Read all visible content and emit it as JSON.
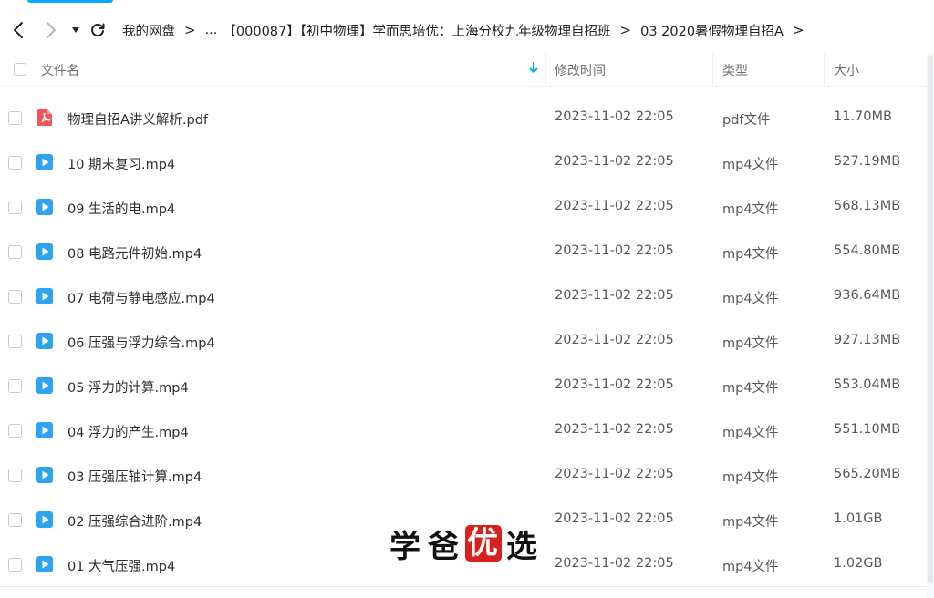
{
  "nav": {
    "breadcrumb": {
      "root": "我的网盘",
      "ellipsis": "...",
      "folder": "【000087】【初中物理】学而思培优：上海分校九年级物理自招班",
      "current": "03 2020暑假物理自招A"
    },
    "separator": ">"
  },
  "table": {
    "columns": {
      "name": "文件名",
      "time": "修改时间",
      "type": "类型",
      "size": "大小"
    },
    "rows": [
      {
        "name": "物理自招A讲义解析.pdf",
        "time": "2023-11-02 22:05",
        "type": "pdf文件",
        "size": "11.70MB",
        "icon": "pdf-icon"
      },
      {
        "name": "10 期末复习.mp4",
        "time": "2023-11-02 22:05",
        "type": "mp4文件",
        "size": "527.19MB",
        "icon": "video-icon"
      },
      {
        "name": "09 生活的电.mp4",
        "time": "2023-11-02 22:05",
        "type": "mp4文件",
        "size": "568.13MB",
        "icon": "video-icon"
      },
      {
        "name": "08 电路元件初始.mp4",
        "time": "2023-11-02 22:05",
        "type": "mp4文件",
        "size": "554.80MB",
        "icon": "video-icon"
      },
      {
        "name": "07 电荷与静电感应.mp4",
        "time": "2023-11-02 22:05",
        "type": "mp4文件",
        "size": "936.64MB",
        "icon": "video-icon"
      },
      {
        "name": "06 压强与浮力综合.mp4",
        "time": "2023-11-02 22:05",
        "type": "mp4文件",
        "size": "927.13MB",
        "icon": "video-icon"
      },
      {
        "name": "05 浮力的计算.mp4",
        "time": "2023-11-02 22:05",
        "type": "mp4文件",
        "size": "553.04MB",
        "icon": "video-icon"
      },
      {
        "name": "04 浮力的产生.mp4",
        "time": "2023-11-02 22:05",
        "type": "mp4文件",
        "size": "551.10MB",
        "icon": "video-icon"
      },
      {
        "name": "03 压强压轴计算.mp4",
        "time": "2023-11-02 22:05",
        "type": "mp4文件",
        "size": "565.20MB",
        "icon": "video-icon"
      },
      {
        "name": "02 压强综合进阶.mp4",
        "time": "2023-11-02 22:05",
        "type": "mp4文件",
        "size": "1.01GB",
        "icon": "video-icon"
      },
      {
        "name": "01 大气压强.mp4",
        "time": "2023-11-02 22:05",
        "type": "mp4文件",
        "size": "1.02GB",
        "icon": "video-icon"
      }
    ]
  },
  "watermark": {
    "c1": "学",
    "c2": "爸",
    "c3": "优",
    "c4": "选"
  },
  "colors": {
    "accent": "#06a7ff",
    "pdf": "#f0575a",
    "video": "#2ea3f2",
    "seal": "#d8201d"
  }
}
